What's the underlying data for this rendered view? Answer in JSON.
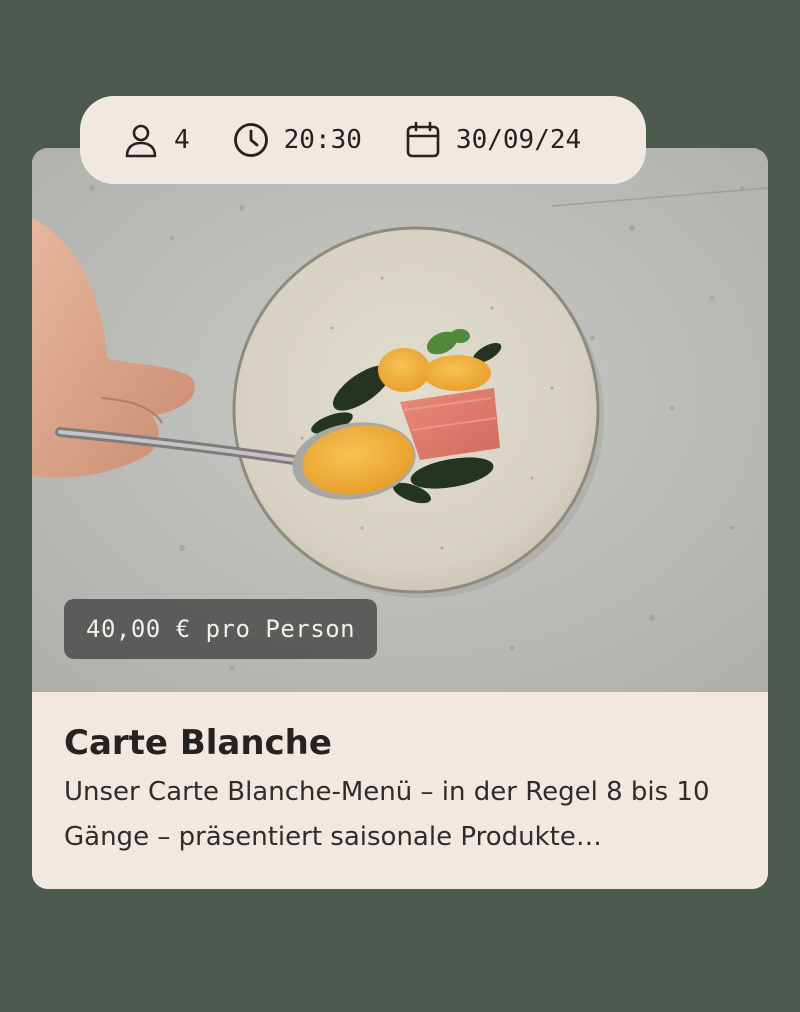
{
  "booking": {
    "guests": "4",
    "time": "20:30",
    "date": "30/09/24",
    "icons": {
      "guests": "person-icon",
      "time": "clock-icon",
      "date": "calendar-icon"
    }
  },
  "card": {
    "price_label": "40,00 € pro Person",
    "title": "Carte Blanche",
    "description": "Unser Carte Blanche-Menü – in der Regel 8 bis 10 Gänge – präsentiert saisonale Produkte…",
    "image": "plated-dish-with-spoon"
  },
  "colors": {
    "background": "#4d5a4f",
    "card": "#f1e8e2",
    "text": "#252322",
    "badge": "#4e4e4e"
  }
}
